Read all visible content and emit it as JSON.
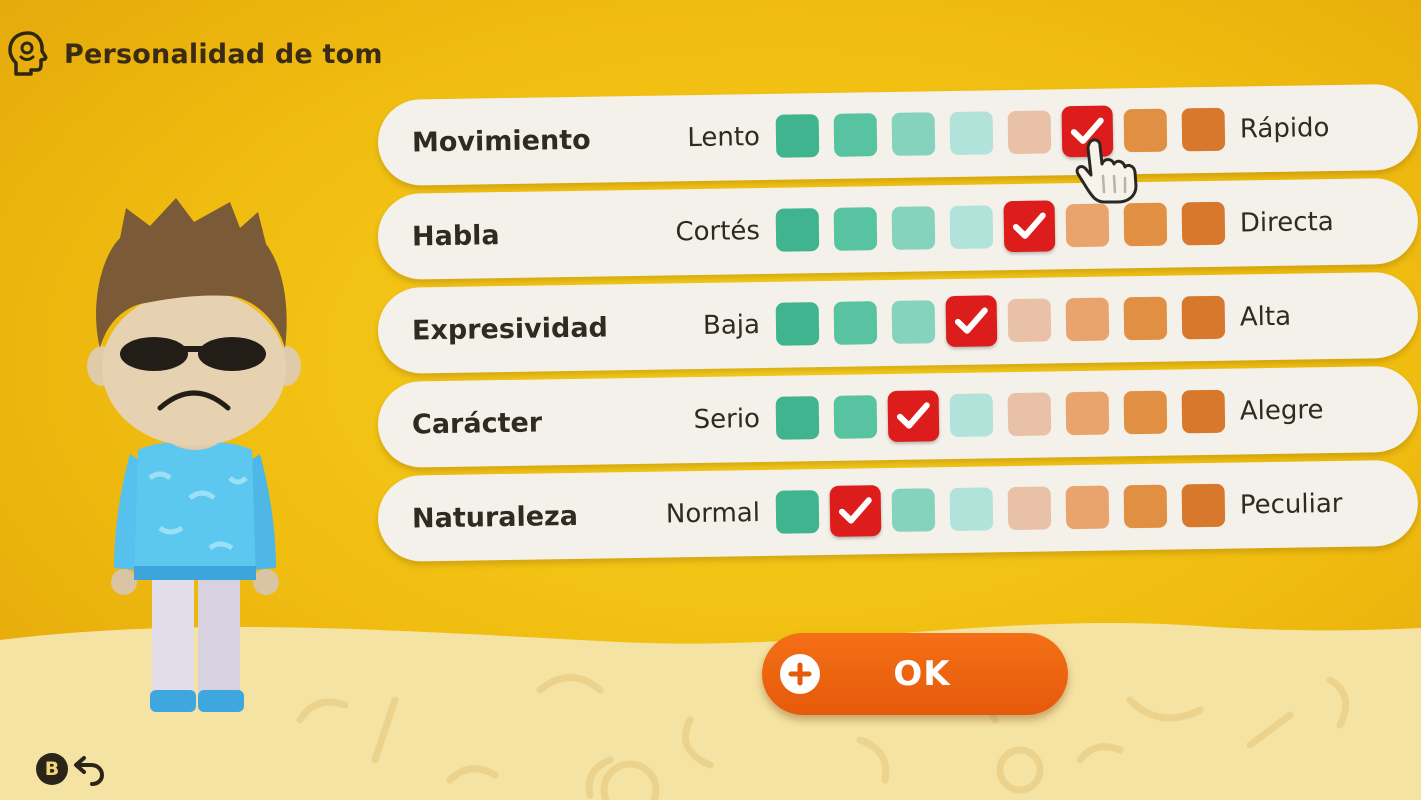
{
  "header": {
    "title": "Personalidad de tom",
    "icon": "personality-head-icon"
  },
  "colors": {
    "scale": [
      "#3fb48e",
      "#58c3a0",
      "#85d3bc",
      "#b1e3da",
      "#e8c1a6",
      "#e8a46c",
      "#e08f43",
      "#d8782c"
    ],
    "selected": "#dd1c1c",
    "ok_button": "#ee6510"
  },
  "traits": [
    {
      "label": "Movimiento",
      "left": "Lento",
      "right": "Rápido",
      "selected": 6,
      "steps": 8
    },
    {
      "label": "Habla",
      "left": "Cortés",
      "right": "Directa",
      "selected": 5,
      "steps": 8
    },
    {
      "label": "Expresividad",
      "left": "Baja",
      "right": "Alta",
      "selected": 4,
      "steps": 8
    },
    {
      "label": "Carácter",
      "left": "Serio",
      "right": "Alegre",
      "selected": 3,
      "steps": 8
    },
    {
      "label": "Naturaleza",
      "left": "Normal",
      "right": "Peculiar",
      "selected": 2,
      "steps": 8
    }
  ],
  "ok_button": {
    "label": "OK",
    "icon": "plus-button-icon"
  },
  "back": {
    "button": "B",
    "icon": "back-arrow-icon"
  }
}
